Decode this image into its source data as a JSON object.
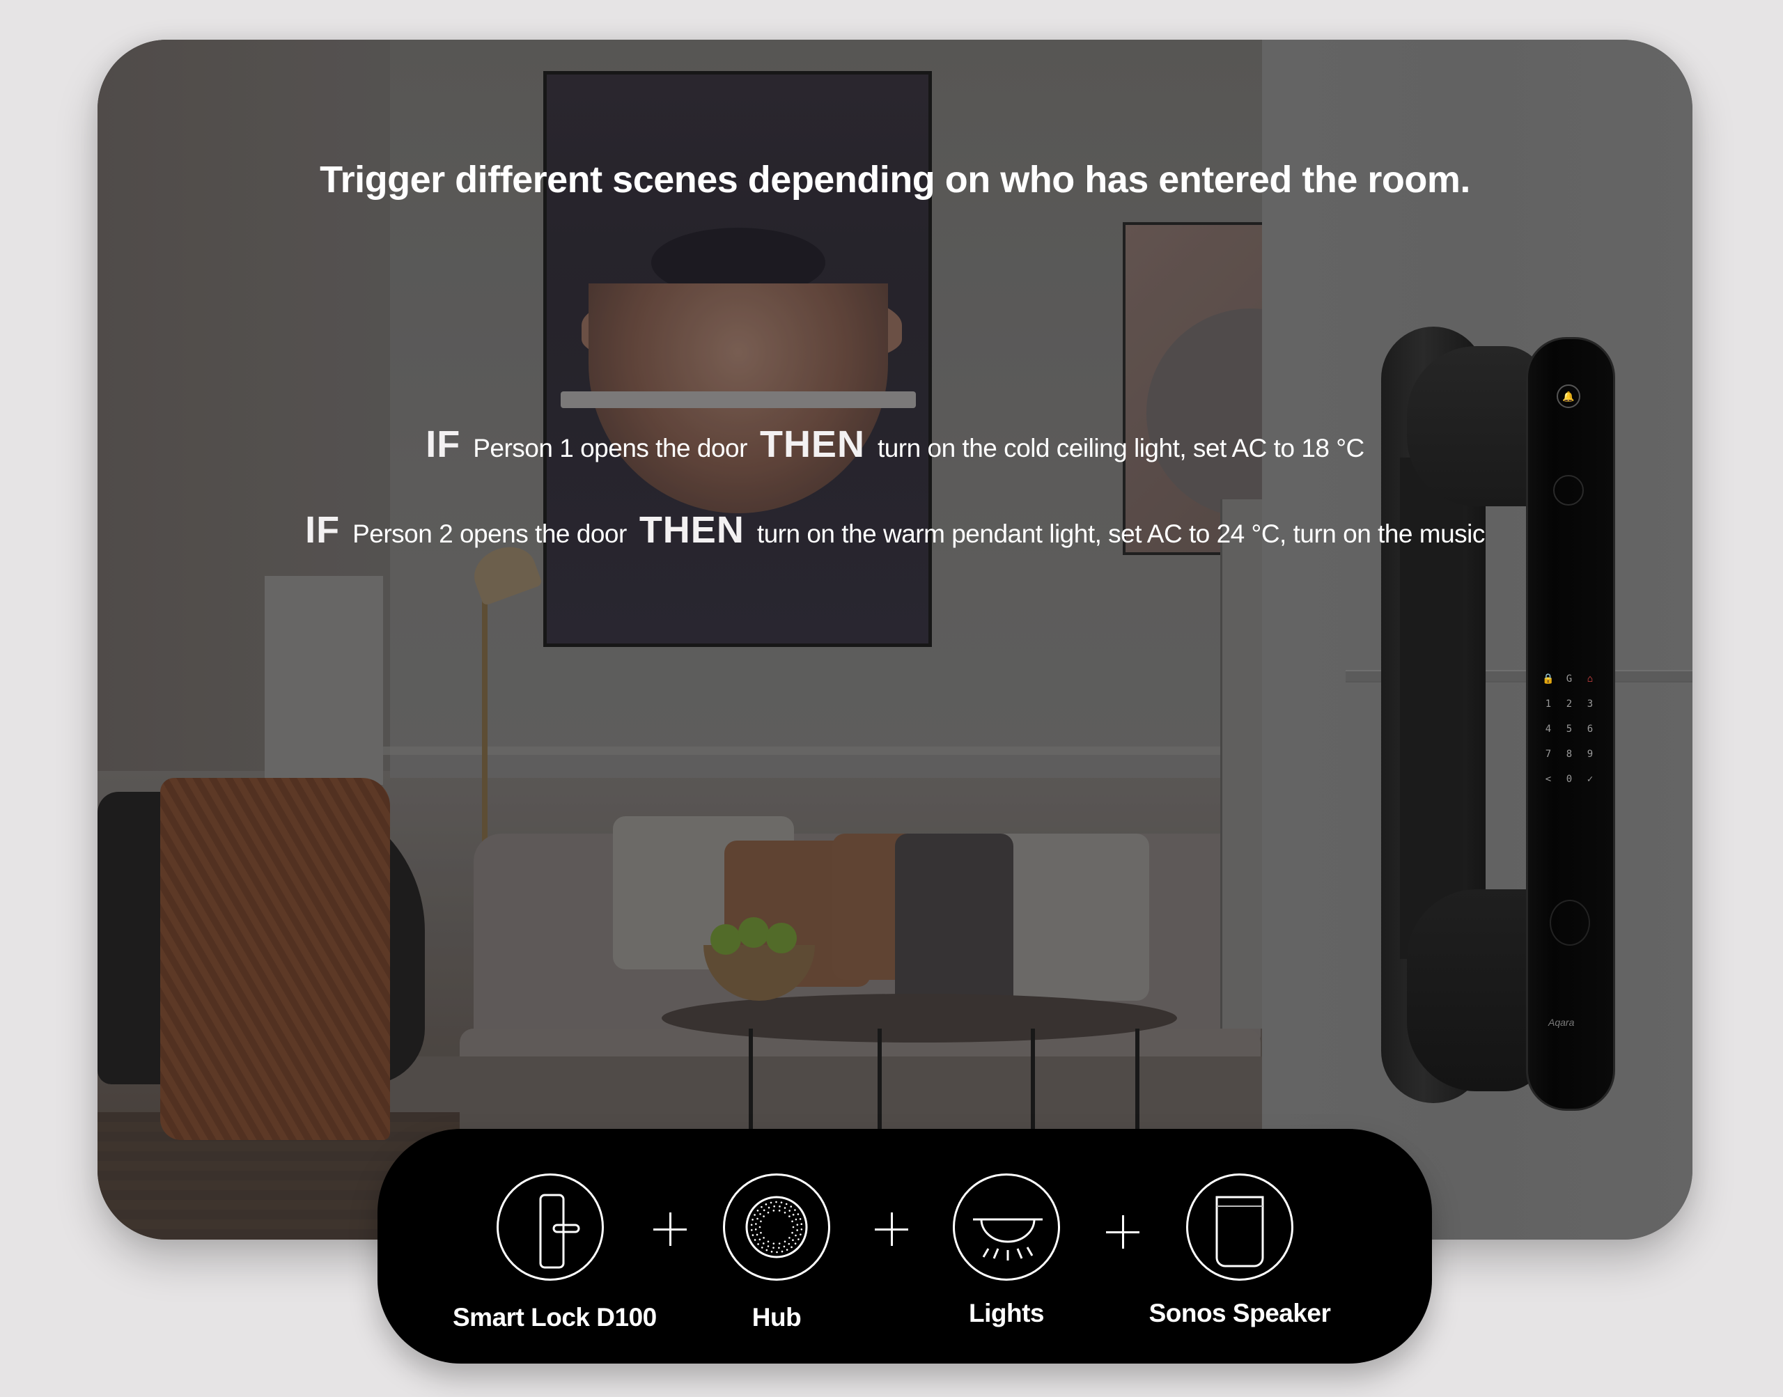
{
  "headline": "Trigger different scenes depending on who has entered the room.",
  "rules": [
    {
      "if_keyword": "IF",
      "condition": "Person 1 opens the door",
      "then_keyword": "THEN",
      "action": "turn on the cold ceiling light, set AC to 18 °C"
    },
    {
      "if_keyword": "IF",
      "condition": "Person 2 opens the door",
      "then_keyword": "THEN",
      "action": "turn on the warm pendant light, set AC to 24 °C, turn on the music"
    }
  ],
  "devices": [
    {
      "label": "Smart Lock D100",
      "icon": "smart-lock-icon"
    },
    {
      "label": "Hub",
      "icon": "hub-icon"
    },
    {
      "label": "Lights",
      "icon": "ceiling-light-icon"
    },
    {
      "label": "Sonos Speaker",
      "icon": "speaker-icon"
    }
  ],
  "connector_symbol": "+",
  "lock_product": {
    "brand": "Aqara",
    "keypad": [
      "🔒",
      "G",
      "⌂",
      "1",
      "2",
      "3",
      "4",
      "5",
      "6",
      "7",
      "8",
      "9",
      "<",
      "0",
      "✓"
    ],
    "bell_glyph": "🔔"
  },
  "colors": {
    "page_background": "#e6e4e5",
    "card_overlay": "#636363",
    "panel_background": "#000000",
    "text": "#ffffff",
    "keypad_accent": "#b33a3a"
  }
}
